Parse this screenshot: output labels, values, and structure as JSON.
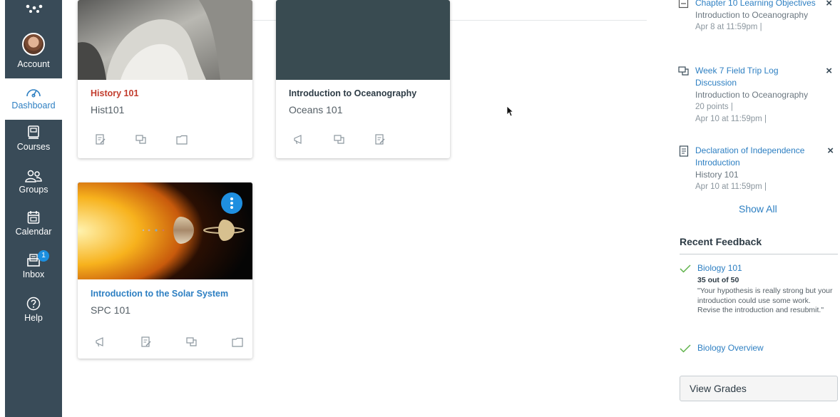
{
  "global_nav": {
    "items": [
      {
        "label": "Account"
      },
      {
        "label": "Dashboard"
      },
      {
        "label": "Courses"
      },
      {
        "label": "Groups"
      },
      {
        "label": "Calendar"
      },
      {
        "label": "Inbox",
        "badge": "1"
      },
      {
        "label": "Help"
      }
    ]
  },
  "cards": [
    {
      "title": "History 101",
      "code": "Hist101",
      "title_color": "#c23c2d",
      "icons": [
        "assignments-icon",
        "discussions-icon",
        "files-icon"
      ]
    },
    {
      "title": "Introduction to Oceanography",
      "code": "Oceans 101",
      "title_color": "#2d3b45",
      "hero_color": "#394b51",
      "icons": [
        "announcements-icon",
        "discussions-icon",
        "assignments-icon"
      ]
    },
    {
      "title": "Introduction to the Solar System",
      "code": "SPC 101",
      "title_color": "#2d7fc2",
      "icons": [
        "announcements-icon",
        "assignments-icon",
        "discussions-icon",
        "files-icon"
      ]
    }
  ],
  "todo": {
    "items": [
      {
        "title": "Chapter 10 Learning Objectives",
        "course": "Introduction to Oceanography",
        "meta": [
          "Apr 8 at 11:59pm  |"
        ],
        "icon": "quiz-icon"
      },
      {
        "title": "Week 7 Field Trip Log Discussion",
        "course": "Introduction to Oceanography",
        "meta": [
          "20 points  |",
          "Apr 10 at 11:59pm  |"
        ],
        "icon": "discussion-icon"
      },
      {
        "title": "Declaration of Independence Introduction",
        "course": "History 101",
        "meta": [
          "Apr 10 at 11:59pm  |"
        ],
        "icon": "document-icon"
      }
    ],
    "show_all": "Show All"
  },
  "recent_feedback": {
    "heading": "Recent Feedback",
    "items": [
      {
        "title": "Biology 101",
        "score": "35 out of 50",
        "comment": "\"Your hypothesis is really strong but your introduction could use some work. Revise the introduction and resubmit.\""
      },
      {
        "title": "Biology Overview"
      }
    ],
    "view_grades": "View Grades"
  },
  "colors": {
    "nav_bg": "#394b58",
    "link": "#2d7fc2",
    "accent": "#1f8fe0"
  }
}
